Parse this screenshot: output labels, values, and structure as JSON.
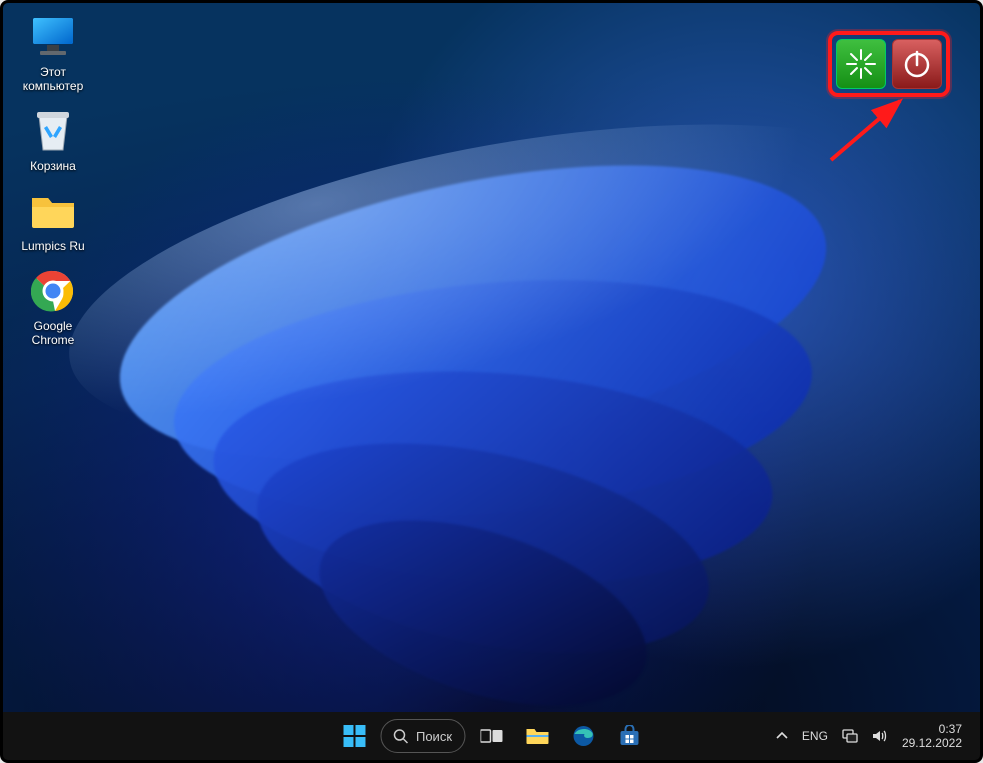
{
  "desktop_icons": [
    {
      "name": "this-pc",
      "label": "Этот\nкомпьютер"
    },
    {
      "name": "recycle-bin",
      "label": "Корзина"
    },
    {
      "name": "folder-lumpics",
      "label": "Lumpics Ru"
    },
    {
      "name": "google-chrome",
      "label": "Google\nChrome"
    }
  ],
  "annotation": {
    "restart_button": "restart",
    "shutdown_button": "shutdown"
  },
  "taskbar": {
    "search_label": "Поиск"
  },
  "tray": {
    "language": "ENG",
    "time": "0:37",
    "date": "29.12.2022"
  }
}
